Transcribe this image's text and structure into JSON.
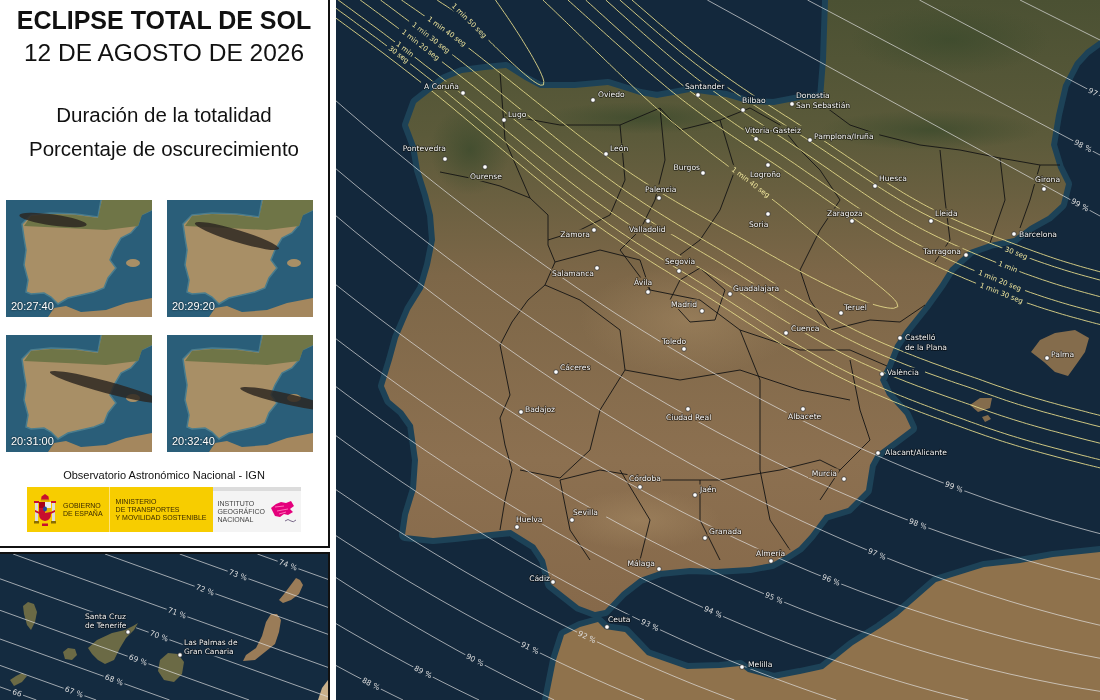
{
  "header": {
    "title": "ECLIPSE TOTAL DE SOL",
    "date": "12 DE AGOSTO DE 2026",
    "legend": [
      "Duración de la totalidad",
      "Porcentaje de oscurecimiento"
    ]
  },
  "thumbnails": [
    {
      "time": "20:27:40"
    },
    {
      "time": "20:29:20"
    },
    {
      "time": "20:31:00"
    },
    {
      "time": "20:32:40"
    }
  ],
  "credits": {
    "observatory": "Observatorio Astronómico Nacional - IGN",
    "government": [
      "GOBIERNO",
      "DE ESPAÑA"
    ],
    "ministry": [
      "MINISTERIO",
      "DE TRANSPORTES",
      "Y MOVILIDAD SOSTENIBLE"
    ],
    "institute": [
      "INSTITUTO",
      "GEOGRÁFICO",
      "NACIONAL"
    ]
  },
  "canary_inset": {
    "obscuration_labels": [
      "74 %",
      "73 %",
      "72 %",
      "71 %",
      "70 %",
      "69 %",
      "68 %",
      "67 %",
      "66"
    ],
    "cities": [
      {
        "label_lines": [
          "Santa Cruz",
          "de Tenerife"
        ]
      },
      {
        "label_lines": [
          "Las Palmas de",
          "Gran Canaria"
        ]
      }
    ]
  },
  "main_map": {
    "duration_labels": [
      "1 min 50 seg",
      "1 min 40 seg",
      "1 min 30 seg",
      "1 min 20 seg",
      "1 min",
      "30 seg",
      "1 min 40 seg",
      "30 seg",
      "1 min",
      "1 min 20 seg",
      "1 min 30 seg"
    ],
    "obscuration_labels": [
      "97",
      "98 %",
      "99 %",
      "99 %",
      "98 %",
      "97 %",
      "96 %",
      "95 %",
      "94 %",
      "93 %",
      "92 %",
      "91 %",
      "90 %",
      "89 %",
      "88 %"
    ],
    "cities": [
      {
        "label_lines": [
          "A Coruña"
        ]
      },
      {
        "label_lines": [
          "Santander"
        ]
      },
      {
        "label_lines": [
          "Oviedo"
        ]
      },
      {
        "label_lines": [
          "Bilbao"
        ]
      },
      {
        "label_lines": [
          "Donostia",
          "San Sebastián"
        ]
      },
      {
        "label_lines": [
          "Lugo"
        ]
      },
      {
        "label_lines": [
          "Vitoria-Gasteiz"
        ]
      },
      {
        "label_lines": [
          "Pamplona/Iruña"
        ]
      },
      {
        "label_lines": [
          "Pontevedra"
        ]
      },
      {
        "label_lines": [
          "León"
        ]
      },
      {
        "label_lines": [
          "Burgos"
        ]
      },
      {
        "label_lines": [
          "Ourense"
        ]
      },
      {
        "label_lines": [
          "Logroño"
        ]
      },
      {
        "label_lines": [
          "Huesca"
        ]
      },
      {
        "label_lines": [
          "Girona"
        ]
      },
      {
        "label_lines": [
          "Palencia"
        ]
      },
      {
        "label_lines": [
          "Zaragoza"
        ]
      },
      {
        "label_lines": [
          "Lleida"
        ]
      },
      {
        "label_lines": [
          "Zamora"
        ]
      },
      {
        "label_lines": [
          "Valladolid"
        ]
      },
      {
        "label_lines": [
          "Soria"
        ]
      },
      {
        "label_lines": [
          "Barcelona"
        ]
      },
      {
        "label_lines": [
          "Tarragona"
        ]
      },
      {
        "label_lines": [
          "Segovia"
        ]
      },
      {
        "label_lines": [
          "Salamanca"
        ]
      },
      {
        "label_lines": [
          "Ávila"
        ]
      },
      {
        "label_lines": [
          "Guadalajara"
        ]
      },
      {
        "label_lines": [
          "Madrid"
        ]
      },
      {
        "label_lines": [
          "Teruel"
        ]
      },
      {
        "label_lines": [
          "Cuenca"
        ]
      },
      {
        "label_lines": [
          "Toledo"
        ]
      },
      {
        "label_lines": [
          "Castelló",
          "de la Plana"
        ]
      },
      {
        "label_lines": [
          "Palma"
        ]
      },
      {
        "label_lines": [
          "Cáceres"
        ]
      },
      {
        "label_lines": [
          "València"
        ]
      },
      {
        "label_lines": [
          "Badajoz"
        ]
      },
      {
        "label_lines": [
          "Ciudad Real"
        ]
      },
      {
        "label_lines": [
          "Albacete"
        ]
      },
      {
        "label_lines": [
          "Alacant/Alicante"
        ]
      },
      {
        "label_lines": [
          "Córdoba"
        ]
      },
      {
        "label_lines": [
          "Murcia"
        ]
      },
      {
        "label_lines": [
          "Jaén"
        ]
      },
      {
        "label_lines": [
          "Huelva"
        ]
      },
      {
        "label_lines": [
          "Sevilla"
        ]
      },
      {
        "label_lines": [
          "Granada"
        ]
      },
      {
        "label_lines": [
          "Almería"
        ]
      },
      {
        "label_lines": [
          "Málaga"
        ]
      },
      {
        "label_lines": [
          "Cádiz"
        ]
      },
      {
        "label_lines": [
          "Ceuta"
        ]
      },
      {
        "label_lines": [
          "Melilla"
        ]
      }
    ]
  }
}
